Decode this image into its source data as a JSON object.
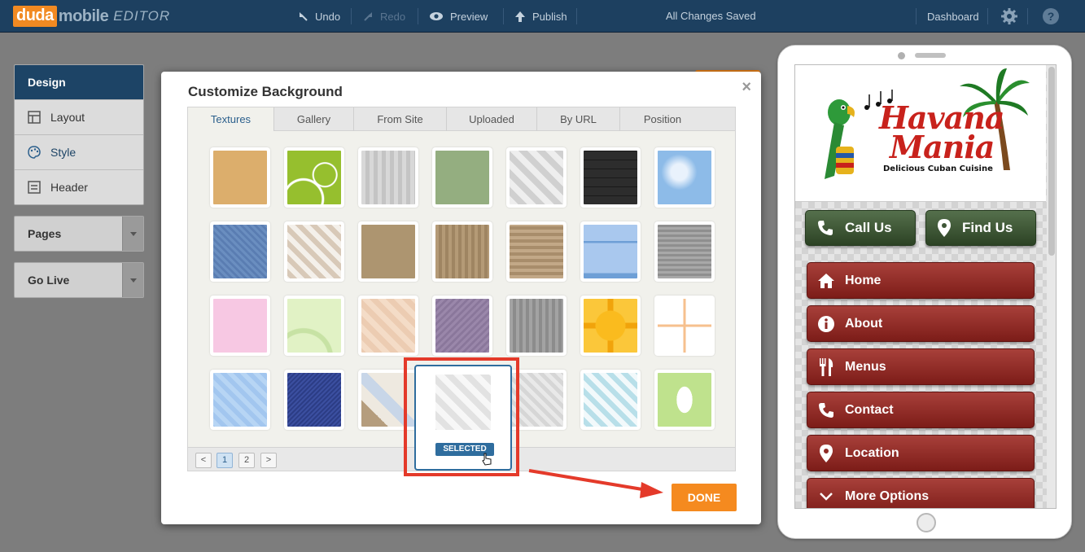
{
  "topbar": {
    "logo_duda": "duda",
    "logo_mobile": "mobile",
    "logo_editor": "EDITOR",
    "undo": "Undo",
    "redo": "Redo",
    "preview": "Preview",
    "publish": "Publish",
    "status": "All Changes Saved",
    "dashboard": "Dashboard"
  },
  "left_panel": {
    "design": "Design",
    "items": [
      {
        "label": "Layout"
      },
      {
        "label": "Style"
      },
      {
        "label": "Header"
      }
    ],
    "pages": "Pages",
    "go_live": "Go Live"
  },
  "modal": {
    "title": "Customize Background",
    "close": "×",
    "tabs": [
      {
        "label": "Textures"
      },
      {
        "label": "Gallery"
      },
      {
        "label": "From Site"
      },
      {
        "label": "Uploaded"
      },
      {
        "label": "By URL"
      },
      {
        "label": "Position"
      }
    ],
    "selected_badge": "SELECTED",
    "pager": {
      "prev": "<",
      "p1": "1",
      "p2": "2",
      "next": ">"
    },
    "done": "DONE"
  },
  "phone": {
    "logo_line1": "Havana",
    "logo_line2": "Mania",
    "logo_tagline": "Delicious Cuban Cuisine",
    "call_us": "Call Us",
    "find_us": "Find Us",
    "nav": [
      {
        "label": "Home"
      },
      {
        "label": "About"
      },
      {
        "label": "Menus"
      },
      {
        "label": "Contact"
      },
      {
        "label": "Location"
      },
      {
        "label": "More Options"
      }
    ]
  },
  "colors": {
    "topbar": "#1d4060",
    "accent_orange": "#f58a1f",
    "highlight_red": "#e43a2a",
    "nav_button": "#8e2a25",
    "cta_button": "#3f5637"
  }
}
